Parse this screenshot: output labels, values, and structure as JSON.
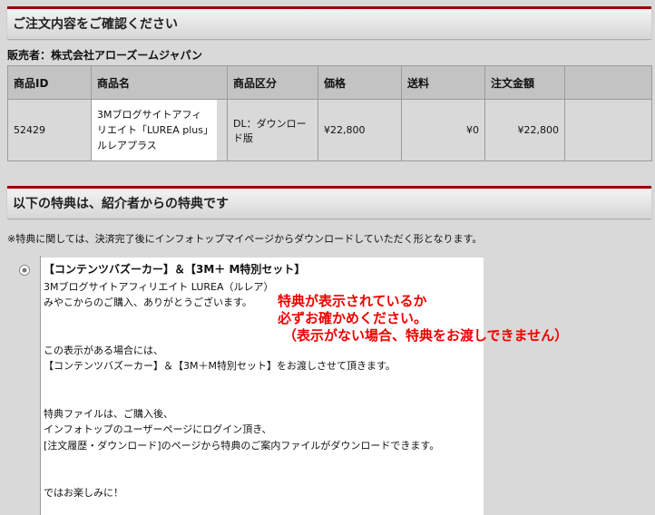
{
  "order_section": {
    "title": "ご注文内容をご確認ください",
    "seller": "販売者：株式会社アローズームジャパン",
    "columns": [
      "商品ID",
      "商品名",
      "商品区分",
      "価格",
      "送料",
      "注文金額"
    ],
    "row": {
      "id": "52429",
      "name": "3Mブログサイトアフィリエイト「LUREA plus」ルレアプラス",
      "category": "DL：ダウンロード版",
      "price": "¥22,800",
      "shipping": "¥0",
      "total": "¥22,800"
    }
  },
  "bonus_section": {
    "title": "以下の特典は、紹介者からの特典です",
    "notice": "※特典に関しては、決済完了後にインフォトップマイページからダウンロードしていただく形となります。",
    "bonus": {
      "title": "【コンテンツバズーカー】＆【3M＋ M特別セット】",
      "line1": "3Mブログサイトアフィリエイト LUREA（ルレア）",
      "line2": "みやこからのご購入、ありがとうございます。",
      "line3": "この表示がある場合には、",
      "line4": "【コンテンツバズーカー】＆【3M＋M特別セット】をお渡しさせて頂きます。",
      "line5": "特典ファイルは、ご購入後、",
      "line6": "インフォトップのユーザーページにログイン頂き、",
      "line7": "[注文履歴・ダウンロード]のページから特典のご案内ファイルがダウンロードできます。",
      "line8": "ではお楽しみに！"
    },
    "overlay": {
      "line1": "特典が表示されているか",
      "line2": "必ずお確かめください。",
      "line3": "（表示がない場合、特典をお渡しできません）"
    }
  }
}
